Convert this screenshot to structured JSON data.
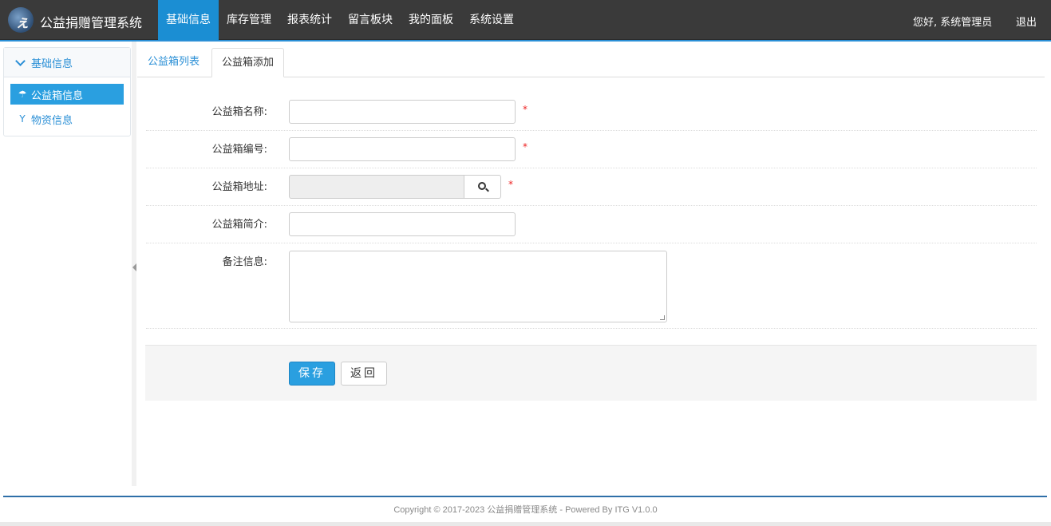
{
  "app": {
    "title": "公益捐赠管理系统",
    "logo_icon": "runner-logo-icon"
  },
  "nav": {
    "items": [
      "基础信息",
      "库存管理",
      "报表统计",
      "留言板块",
      "我的面板",
      "系统设置"
    ],
    "active": "基础信息"
  },
  "user": {
    "greeting": "您好, 系统管理员",
    "logout": "退出"
  },
  "sidebar": {
    "section_title": "基础信息",
    "items": [
      {
        "label": "公益箱信息",
        "icon": "umbrella-icon",
        "active": true
      },
      {
        "label": "物资信息",
        "icon": "filter-icon",
        "active": false
      }
    ]
  },
  "tabs": [
    {
      "label": "公益箱列表",
      "active": false
    },
    {
      "label": "公益箱添加",
      "active": true
    }
  ],
  "form": {
    "name_label": "公益箱名称:",
    "name_value": "",
    "code_label": "公益箱编号:",
    "code_value": "",
    "address_label": "公益箱地址:",
    "address_value": "",
    "intro_label": "公益箱简介:",
    "intro_value": "",
    "remark_label": "备注信息:",
    "remark_value": "",
    "required_mark": "*"
  },
  "actions": {
    "save": "保存",
    "back": "返回"
  },
  "footer": {
    "text": "Copyright © 2017-2023 公益捐赠管理系统 - Powered By ITG V1.0.0"
  },
  "colors": {
    "topbar": "#3a3a3a",
    "accent": "#2a9fe0",
    "nav_active": "#1b8ed3",
    "required": "#e22222"
  }
}
